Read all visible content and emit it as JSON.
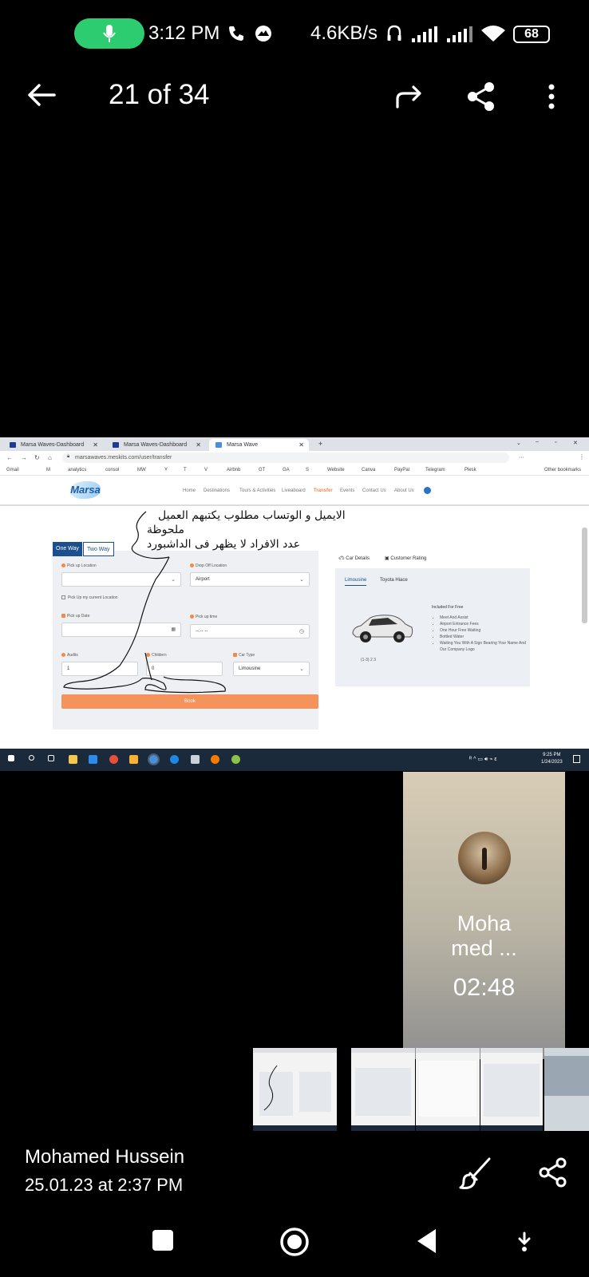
{
  "status_bar": {
    "time": "3:12 PM",
    "net_speed": "4.6KB/s",
    "battery": "68"
  },
  "viewer": {
    "counter": "21 of 34",
    "sender": "Mohamed Hussein",
    "sent_at": "25.01.23 at 2:37 PM"
  },
  "call": {
    "name": "Moha\nmed ...",
    "duration": "02:48"
  },
  "screenshot": {
    "tabs": [
      "Marsa Waves-Dashboard",
      "Marsa Waves-Dashboard",
      "Marsa Wave"
    ],
    "url": "marsawaves.meskits.com/user/transfer",
    "bookmarks": [
      "Gmail",
      "M",
      "analytics",
      "consol",
      "MW",
      "Y",
      "T",
      "V",
      "Airbnb",
      "GT",
      "GA",
      "S",
      "Website",
      "Canva",
      "PayPal",
      "Telegram",
      "Plesk",
      "Other bookmarks"
    ],
    "site_logo": "Marsa",
    "nav": [
      "Home",
      "Destinations",
      "Tours & Activities",
      "Liveaboard",
      "Transfer",
      "Events",
      "Contact Us",
      "About Us"
    ],
    "annotations": [
      "الايميل و الوتساب مطلوب يكتبهم العميل",
      "ملحوظة",
      "عدد الافراد لا يظهر فى الداشبورد"
    ],
    "form": {
      "one_way": "One Way",
      "two_way": "Two Way",
      "pickup_location_label": "Pick up Location",
      "dropoff_location_label": "Drop Off Location",
      "dropoff_value": "Airport",
      "current_location_label": "Pick Up my current Location",
      "pickup_date_label": "Pick up Date",
      "pickup_time_label": "Pick up time",
      "pickup_time_placeholder": "--:-- --",
      "adults_label": "Audits",
      "adults_value": "1",
      "children_label": "Childern",
      "children_value": "0",
      "car_type_label": "Car Type",
      "car_type_value": "Limousine",
      "book_button": "Book"
    },
    "car_panel": {
      "tab_details": "Car Details",
      "tab_rating": "Customer Rating",
      "car_tabs": [
        "Limousine",
        "Toyota Hiace"
      ],
      "included_title": "Included For Free",
      "included": [
        "Meet And Assist",
        "Airport Entrance Fees",
        "One Hour Free Waiting",
        "Bottled Water",
        "Waiting You With A Sign Bearing Your Name And Our Company Logo"
      ],
      "capacity": "(1-3) 2 3"
    },
    "taskbar": {
      "time": "9:25 PM",
      "date": "1/24/2023"
    }
  }
}
